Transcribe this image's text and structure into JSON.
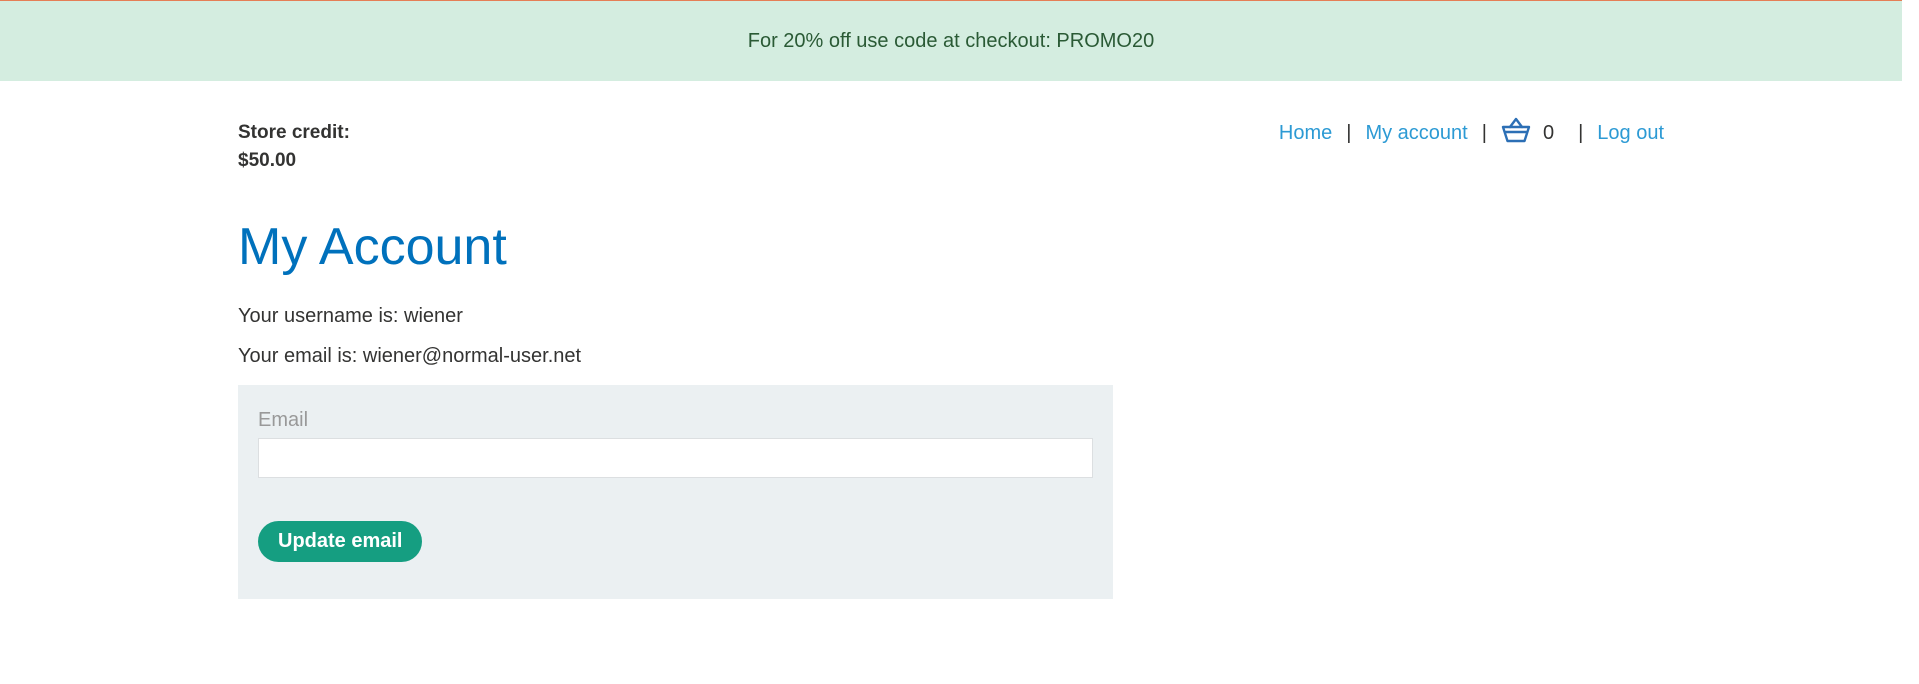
{
  "banner": {
    "text": "For 20% off use code at checkout: PROMO20"
  },
  "store_credit": {
    "label": "Store credit:",
    "amount": "$50.00"
  },
  "nav": {
    "home": "Home",
    "my_account": "My account",
    "separator": "|",
    "cart_count": "0",
    "logout": "Log out",
    "cart_icon": "basket-icon"
  },
  "page": {
    "title": "My Account",
    "username_line": "Your username is: wiener",
    "email_line": "Your email is: wiener@normal-user.net"
  },
  "form": {
    "email_label": "Email",
    "email_value": "",
    "submit_label": "Update email"
  },
  "colors": {
    "banner_bg": "#d4ede0",
    "banner_border": "#e57e56",
    "link": "#2c9ad4",
    "title": "#0071bc",
    "button": "#159e81",
    "panel": "#ebf0f2"
  }
}
